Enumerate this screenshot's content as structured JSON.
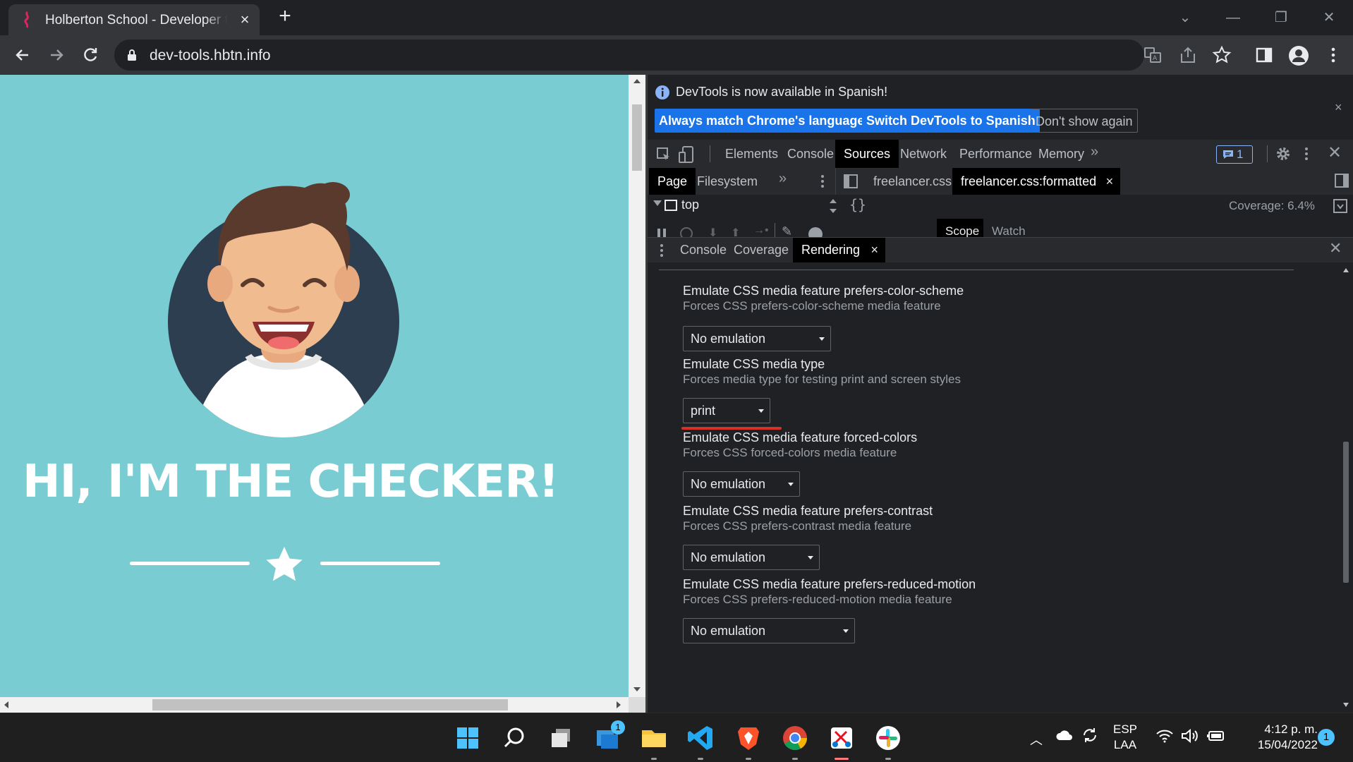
{
  "browser": {
    "tab_title": "Holberton School - Developer tools",
    "new_tab": "+",
    "url": "dev-tools.hbtn.info"
  },
  "page": {
    "headline": "HI, I'M THE CHECKER!"
  },
  "devtools": {
    "infobar": {
      "message": "DevTools is now available in Spanish!",
      "btn_match": "Always match Chrome's language",
      "btn_switch": "Switch DevTools to Spanish",
      "btn_dismiss": "Don't show again"
    },
    "main_tabs": [
      "Elements",
      "Console",
      "Sources",
      "Network",
      "Performance",
      "Memory"
    ],
    "issues_count": "1",
    "navigator_tabs": [
      "Page",
      "Filesystem"
    ],
    "editor_tabs": [
      "freelancer.css",
      "freelancer.css:formatted"
    ],
    "frame": "top",
    "coverage": "Coverage: 6.4%",
    "sidebar_tabs": [
      "Scope",
      "Watch"
    ],
    "drawer_tabs": [
      "Console",
      "Coverage",
      "Rendering"
    ],
    "rendering": [
      {
        "title": "Emulate CSS media feature prefers-color-scheme",
        "subtitle": "Forces CSS prefers-color-scheme media feature",
        "value": "No emulation"
      },
      {
        "title": "Emulate CSS media type",
        "subtitle": "Forces media type for testing print and screen styles",
        "value": "print"
      },
      {
        "title": "Emulate CSS media feature forced-colors",
        "subtitle": "Forces CSS forced-colors media feature",
        "value": "No emulation"
      },
      {
        "title": "Emulate CSS media feature prefers-contrast",
        "subtitle": "Forces CSS prefers-contrast media feature",
        "value": "No emulation"
      },
      {
        "title": "Emulate CSS media feature prefers-reduced-motion",
        "subtitle": "Forces CSS prefers-reduced-motion media feature",
        "value": "No emulation"
      }
    ]
  },
  "taskbar": {
    "lang_top": "ESP",
    "lang_bottom": "LAA",
    "time": "4:12 p. m.",
    "date": "15/04/2022",
    "notif_count": "1",
    "store_badge": "1"
  },
  "colors": {
    "page_bg": "#79cdd2",
    "accent_blue": "#1a73e8",
    "underline_red": "#d93025"
  }
}
